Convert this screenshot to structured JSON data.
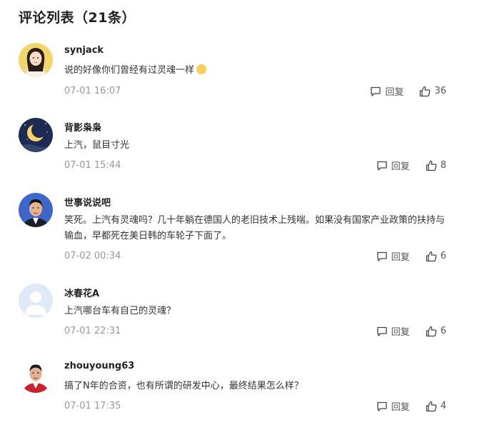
{
  "header": {
    "title": "评论列表（21条）"
  },
  "comments": [
    {
      "username": "synjack",
      "text": "说的好像你们曾经有过灵魂一样",
      "has_emoji": true,
      "time": "07-01 16:07",
      "reply_label": "回复",
      "likes": "36",
      "avatar": "avatar-girl"
    },
    {
      "username": "背影枭枭",
      "text": "上汽，鼠目寸光",
      "time": "07-01 15:44",
      "reply_label": "回复",
      "likes": "8",
      "avatar": "avatar-moon"
    },
    {
      "username": "世事说说吧",
      "text": "笑死。上汽有灵魂吗？几十年躺在德国人的老旧技术上残喘。如果没有国家产业政策的扶持与输血，早都死在美日韩的车轮子下面了。",
      "time": "07-02 00:34",
      "reply_label": "回复",
      "likes": "6",
      "avatar": "avatar-man"
    },
    {
      "username": "冰春花A",
      "text": "上汽哪台车有自己的灵魂？",
      "time": "07-01 22:31",
      "reply_label": "回复",
      "likes": "6",
      "avatar": "avatar-default"
    },
    {
      "username": "zhouyoung63",
      "text": "搞了N年的合资，也有所谓的研发中心，最终结果怎么样？",
      "time": "07-01 17:35",
      "reply_label": "回复",
      "likes": "4",
      "avatar": "avatar-man-red"
    }
  ],
  "colors": {
    "text": "#222222",
    "muted": "#999999",
    "emoji": "#f5cf5a"
  }
}
